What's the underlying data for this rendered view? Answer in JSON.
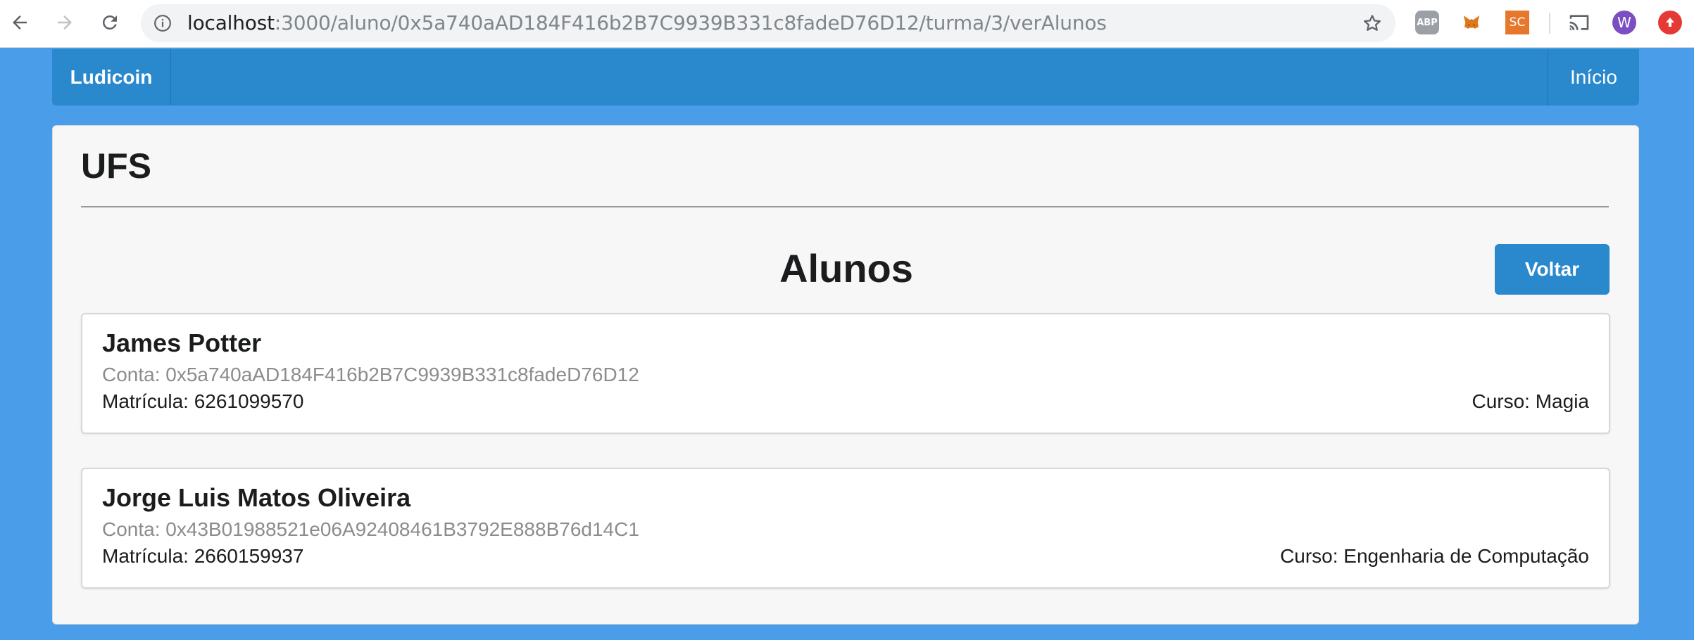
{
  "browser": {
    "url_host": "localhost",
    "url_path": ":3000/aluno/0x5a740aAD184F416b2B7C9939B331c8fadeD76D12/turma/3/verAlunos",
    "extensions": {
      "abp": "ABP",
      "sc": "SC",
      "profile": "W"
    }
  },
  "navbar": {
    "brand": "Ludicoin",
    "home": "Início"
  },
  "page": {
    "organization": "UFS",
    "section_title": "Alunos",
    "back_button": "Voltar"
  },
  "students": [
    {
      "name": "James Potter",
      "account": "Conta: 0x5a740aAD184F416b2B7C9939B331c8fadeD76D12",
      "registration": "Matrícula: 6261099570",
      "course": "Curso: Magia"
    },
    {
      "name": "Jorge Luis Matos Oliveira",
      "account": "Conta: 0x43B01988521e06A92408461B3792E888B76d14C1",
      "registration": "Matrícula: 2660159937",
      "course": "Curso: Engenharia de Computação"
    }
  ],
  "colors": {
    "background": "#4a9de8",
    "primary": "#2a88cd",
    "panel": "#f7f7f7"
  }
}
